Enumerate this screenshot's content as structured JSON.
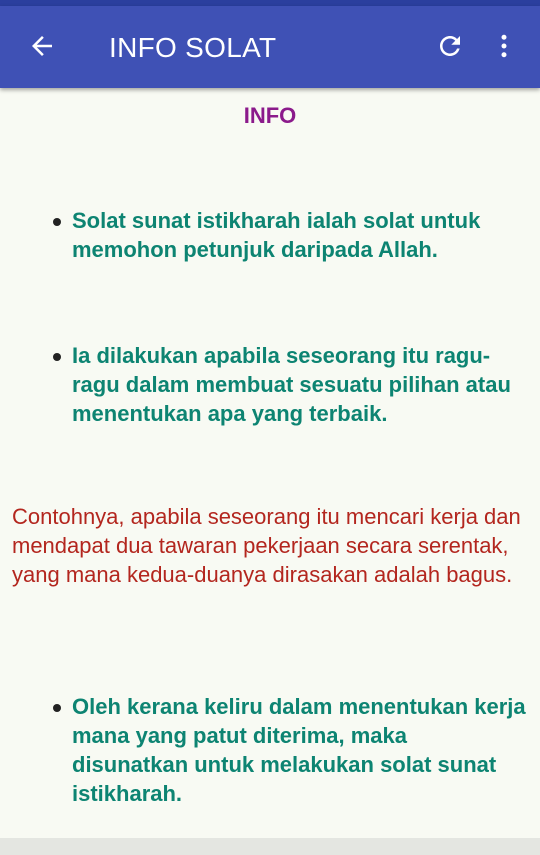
{
  "app_bar": {
    "title": "INFO SOLAT",
    "back_icon": "arrow-left-icon",
    "refresh_icon": "refresh-icon",
    "more_icon": "more-vertical-icon",
    "color": "#3f51b5"
  },
  "content": {
    "heading": "INFO",
    "bullets": [
      "Solat sunat istikharah ialah solat untuk memohon petunjuk daripada Allah.",
      "Ia dilakukan apabila seseorang itu ragu-ragu dalam membuat sesuatu pilihan atau menentukan apa yang terbaik.",
      "Oleh kerana keliru dalam menentukan kerja mana yang patut diterima, maka disunatkan untuk melakukan solat sunat istikharah."
    ],
    "note": "Contohnya, apabila seseorang itu mencari kerja dan mendapat dua tawaran pekerjaan secara serentak, yang mana kedua-duanya dirasakan adalah bagus."
  },
  "colors": {
    "heading": "#8b1a8b",
    "bullet_text": "#0d8472",
    "note_text": "#b3261e"
  }
}
